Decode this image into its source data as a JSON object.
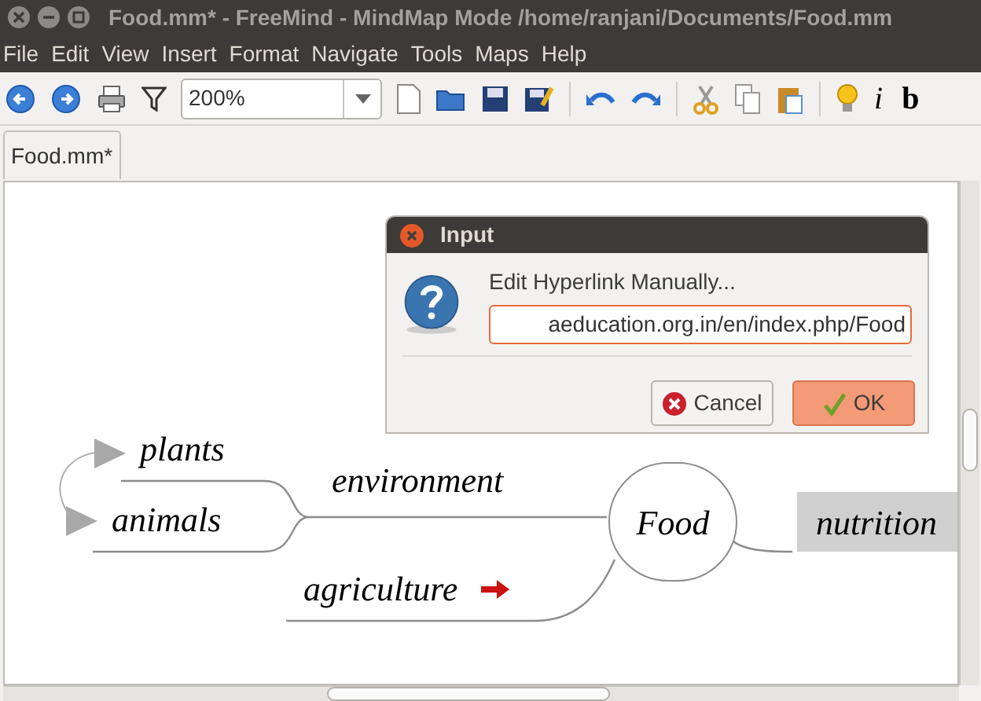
{
  "window": {
    "title": "Food.mm* - FreeMind - MindMap Mode /home/ranjani/Documents/Food.mm"
  },
  "menu": [
    "File",
    "Edit",
    "View",
    "Insert",
    "Format",
    "Navigate",
    "Tools",
    "Maps",
    "Help"
  ],
  "toolbar": {
    "zoom": "200%",
    "format_buttons": [
      "i",
      "b"
    ]
  },
  "tabs": [
    {
      "label": "Food.mm*",
      "selected": true
    }
  ],
  "mindmap": {
    "nodes": [
      {
        "text": "plants",
        "kind": "fork",
        "folded": true,
        "link_icon": false
      },
      {
        "text": "animals",
        "kind": "fork",
        "folded": true,
        "link_icon": false
      },
      {
        "text": "environment",
        "kind": "fork",
        "folded": false,
        "link_icon": false
      },
      {
        "text": "agriculture",
        "kind": "fork",
        "folded": false,
        "link_icon": true
      },
      {
        "text": "Food",
        "kind": "bubble",
        "folded": false,
        "link_icon": false
      },
      {
        "text": "nutrition",
        "kind": "box",
        "folded": false,
        "link_icon": false
      }
    ]
  },
  "dialog": {
    "title": "Input",
    "message": "Edit Hyperlink Manually...",
    "value": "aeducation.org.in/en/index.php/Food",
    "buttons": [
      {
        "label": "Cancel",
        "kind": "cancel"
      },
      {
        "label": "OK",
        "kind": "ok"
      }
    ]
  }
}
